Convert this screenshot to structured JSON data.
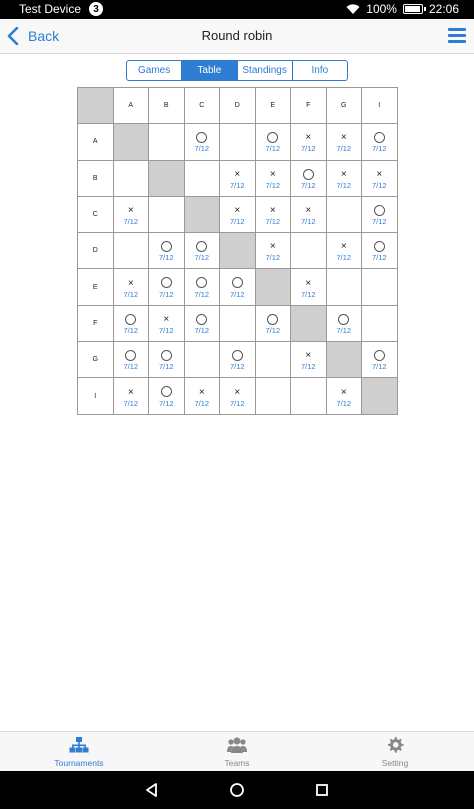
{
  "status_bar": {
    "device_name": "Test Device",
    "badge": "3",
    "battery": "100%",
    "battery_level": 1.0,
    "time": "22:06"
  },
  "nav": {
    "back_label": "Back",
    "title": "Round robin"
  },
  "segments": [
    {
      "label": "Games",
      "active": false
    },
    {
      "label": "Table",
      "active": true
    },
    {
      "label": "Standings",
      "active": false
    },
    {
      "label": "Info",
      "active": false
    }
  ],
  "table": {
    "teams": [
      "A",
      "B",
      "C",
      "D",
      "E",
      "F",
      "G",
      "I"
    ],
    "rows": [
      {
        "team": "A",
        "cells": [
          {
            "k": "diag"
          },
          {
            "k": "empty"
          },
          {
            "k": "win",
            "d": "7/12"
          },
          {
            "k": "empty"
          },
          {
            "k": "win",
            "d": "7/12"
          },
          {
            "k": "loss",
            "d": "7/12"
          },
          {
            "k": "loss",
            "d": "7/12"
          },
          {
            "k": "win",
            "d": "7/12"
          }
        ]
      },
      {
        "team": "B",
        "cells": [
          {
            "k": "empty"
          },
          {
            "k": "diag"
          },
          {
            "k": "empty"
          },
          {
            "k": "loss",
            "d": "7/12"
          },
          {
            "k": "loss",
            "d": "7/12"
          },
          {
            "k": "win",
            "d": "7/12"
          },
          {
            "k": "loss",
            "d": "7/12"
          },
          {
            "k": "loss",
            "d": "7/12"
          }
        ]
      },
      {
        "team": "C",
        "cells": [
          {
            "k": "loss",
            "d": "7/12"
          },
          {
            "k": "empty"
          },
          {
            "k": "diag"
          },
          {
            "k": "loss",
            "d": "7/12"
          },
          {
            "k": "loss",
            "d": "7/12"
          },
          {
            "k": "loss",
            "d": "7/12"
          },
          {
            "k": "empty"
          },
          {
            "k": "win",
            "d": "7/12"
          }
        ]
      },
      {
        "team": "D",
        "cells": [
          {
            "k": "empty"
          },
          {
            "k": "win",
            "d": "7/12"
          },
          {
            "k": "win",
            "d": "7/12"
          },
          {
            "k": "diag"
          },
          {
            "k": "loss",
            "d": "7/12"
          },
          {
            "k": "empty"
          },
          {
            "k": "loss",
            "d": "7/12"
          },
          {
            "k": "win",
            "d": "7/12"
          }
        ]
      },
      {
        "team": "E",
        "cells": [
          {
            "k": "loss",
            "d": "7/12"
          },
          {
            "k": "win",
            "d": "7/12"
          },
          {
            "k": "win",
            "d": "7/12"
          },
          {
            "k": "win",
            "d": "7/12"
          },
          {
            "k": "diag"
          },
          {
            "k": "loss",
            "d": "7/12"
          },
          {
            "k": "empty"
          },
          {
            "k": "empty"
          }
        ]
      },
      {
        "team": "F",
        "cells": [
          {
            "k": "win",
            "d": "7/12"
          },
          {
            "k": "loss",
            "d": "7/12"
          },
          {
            "k": "win",
            "d": "7/12"
          },
          {
            "k": "empty"
          },
          {
            "k": "win",
            "d": "7/12"
          },
          {
            "k": "diag"
          },
          {
            "k": "win",
            "d": "7/12"
          },
          {
            "k": "empty"
          }
        ]
      },
      {
        "team": "G",
        "cells": [
          {
            "k": "win",
            "d": "7/12"
          },
          {
            "k": "win",
            "d": "7/12"
          },
          {
            "k": "empty"
          },
          {
            "k": "win",
            "d": "7/12"
          },
          {
            "k": "empty"
          },
          {
            "k": "loss",
            "d": "7/12"
          },
          {
            "k": "diag"
          },
          {
            "k": "win",
            "d": "7/12"
          }
        ]
      },
      {
        "team": "I",
        "cells": [
          {
            "k": "loss",
            "d": "7/12"
          },
          {
            "k": "win",
            "d": "7/12"
          },
          {
            "k": "loss",
            "d": "7/12"
          },
          {
            "k": "loss",
            "d": "7/12"
          },
          {
            "k": "empty"
          },
          {
            "k": "empty"
          },
          {
            "k": "loss",
            "d": "7/12"
          },
          {
            "k": "diag"
          }
        ]
      }
    ],
    "loss_symbol": "×"
  },
  "tabbar": [
    {
      "label": "Tournaments",
      "icon": "tournament-icon",
      "active": true
    },
    {
      "label": "Teams",
      "icon": "teams-icon",
      "active": false
    },
    {
      "label": "Setting",
      "icon": "gear-icon",
      "active": false
    }
  ],
  "colors": {
    "accent": "#2f7dd3",
    "diagonal": "#cfcfcf"
  }
}
